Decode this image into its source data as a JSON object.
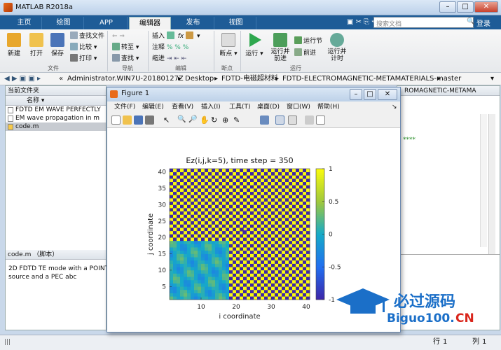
{
  "app": {
    "title": "MATLAB R2018a"
  },
  "tabs": [
    "主页",
    "绘图",
    "APP",
    "编辑器",
    "发布",
    "视图"
  ],
  "active_tab": "编辑器",
  "search": {
    "placeholder": "搜索文档"
  },
  "login": "登录",
  "ribbon": {
    "file": {
      "new": "新建",
      "open": "打开",
      "save": "保存",
      "find_files": "查找文件",
      "compare": "比较",
      "print": "打印",
      "group": "文件"
    },
    "nav": {
      "goto": "转至",
      "find": "查找",
      "group": "导航"
    },
    "edit": {
      "insert": "插入",
      "comment": "注释",
      "indent": "缩进",
      "fx": "fx",
      "group": "编辑"
    },
    "breakpoints": {
      "label": "断点",
      "group": "断点"
    },
    "run": {
      "run": "运行",
      "run_advance": "运行并\n前进",
      "run_section": "运行节",
      "advance": "前进",
      "run_time": "运行并\n计时",
      "group": "运行"
    }
  },
  "path": {
    "items": [
      "Administrator.WIN7U-20180127Z",
      "Desktop",
      "FDTD-电磁超材料",
      "FDTD-ELECTROMAGNETIC-METAMATERIALS-master"
    ],
    "prefix": "«"
  },
  "current_folder": {
    "title": "当前文件夹",
    "column": "名称",
    "files": [
      "FDTD EM WAVE PERFECTLY",
      "EM wave propagation in m",
      "code.m"
    ],
    "selected": 2
  },
  "details": {
    "title": "code.m （脚本）",
    "text": "2D FDTD TE mode with a POINT source and a PEC abc"
  },
  "editor_right": {
    "tab_text": "ROMAGNETIC-METAMA",
    "stars": "****"
  },
  "figure": {
    "title": "Figure 1",
    "menu": [
      "文件(F)",
      "编辑(E)",
      "查看(V)",
      "插入(I)",
      "工具(T)",
      "桌面(D)",
      "窗口(W)",
      "帮助(H)"
    ]
  },
  "chart_data": {
    "type": "heatmap",
    "title": "Ez(i,j,k=5), time step = 350",
    "xlabel": "i coordinate",
    "ylabel": "j coordinate",
    "xlim": [
      1,
      41
    ],
    "ylim": [
      1,
      41
    ],
    "xticks": [
      10,
      20,
      30,
      40
    ],
    "yticks": [
      5,
      10,
      15,
      20,
      25,
      30,
      35,
      40
    ],
    "colorbar": {
      "ticks": [
        1,
        0.5,
        0,
        -0.5,
        -1
      ],
      "labels": [
        "1",
        "0.5",
        "0",
        "-0.5",
        "-1"
      ],
      "range": [
        -1,
        1
      ]
    },
    "regions": [
      {
        "name": "PEC checkerboard",
        "pattern": "alternating +1/-1 cells",
        "x": [
          1,
          41
        ],
        "y": [
          19,
          41
        ]
      },
      {
        "name": "PEC checkerboard",
        "pattern": "alternating +1/-1 cells",
        "x": [
          18,
          41
        ],
        "y": [
          1,
          19
        ]
      },
      {
        "name": "wave field",
        "pattern": "values near 0",
        "x": [
          1,
          18
        ],
        "y": [
          1,
          19
        ]
      }
    ],
    "source_marker": {
      "x": 22,
      "y": 22,
      "symbol": "+"
    }
  },
  "status": {
    "row_label": "行",
    "row": "1",
    "col_label": "列",
    "col": "1"
  },
  "colors": {
    "tabbar": "#1e5c97",
    "cmap_low": "#3e26a8",
    "cmap_high": "#f9fb0e"
  }
}
